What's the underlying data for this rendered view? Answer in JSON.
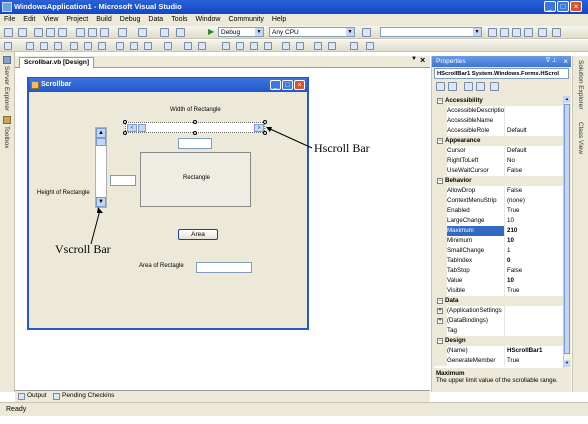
{
  "window": {
    "title": "WindowsApplication1 - Microsoft Visual Studio"
  },
  "menu": [
    "File",
    "Edit",
    "View",
    "Project",
    "Build",
    "Debug",
    "Data",
    "Tools",
    "Window",
    "Community",
    "Help"
  ],
  "toolbar": {
    "config": "Debug",
    "platform": "Any CPU"
  },
  "left_strip": {
    "server_explorer": "Server Explorer",
    "toolbox": "Toolbox"
  },
  "document": {
    "tab_label": "Scrollbar.vb [Design]",
    "close": "×"
  },
  "form": {
    "title": "Scrollbar",
    "width_label": "Width of Rectangle",
    "height_label": "Height of Rectangle",
    "rectangle_label": "Rectangle",
    "area_button": "Area",
    "area_label": "Area of Rectagle"
  },
  "annotations": {
    "hscroll": "Hscroll  Bar",
    "vscroll": "Vscroll  Bar"
  },
  "properties": {
    "title": "Properties",
    "object": "HScrollBar1  System.Windows.Forms.HScrol",
    "rows": [
      {
        "type": "cat",
        "name": "Accessibility"
      },
      {
        "name": "AccessibleDescriptio",
        "value": ""
      },
      {
        "name": "AccessibleName",
        "value": ""
      },
      {
        "name": "AccessibleRole",
        "value": "Default"
      },
      {
        "type": "cat",
        "name": "Appearance"
      },
      {
        "name": "Cursor",
        "value": "Default"
      },
      {
        "name": "RightToLeft",
        "value": "No"
      },
      {
        "name": "UseWaitCursor",
        "value": "False"
      },
      {
        "type": "cat",
        "name": "Behavior"
      },
      {
        "name": "AllowDrop",
        "value": "False"
      },
      {
        "name": "ContextMenuStrip",
        "value": "(none)"
      },
      {
        "name": "Enabled",
        "value": "True"
      },
      {
        "name": "LargeChange",
        "value": "10"
      },
      {
        "name": "Maximum",
        "value": "210",
        "sel": true,
        "bold": true
      },
      {
        "name": "Minimum",
        "value": "10",
        "bold": true
      },
      {
        "name": "SmallChange",
        "value": "1"
      },
      {
        "name": "TabIndex",
        "value": "0",
        "bold": true
      },
      {
        "name": "TabStop",
        "value": "False"
      },
      {
        "name": "Value",
        "value": "10",
        "bold": true
      },
      {
        "name": "Visible",
        "value": "True"
      },
      {
        "type": "cat",
        "name": "Data"
      },
      {
        "name": "(ApplicationSettings",
        "value": "",
        "exp": true
      },
      {
        "name": "(DataBindings)",
        "value": "",
        "exp": true
      },
      {
        "name": "Tag",
        "value": ""
      },
      {
        "type": "cat",
        "name": "Design"
      },
      {
        "name": "(Name)",
        "value": "HScrollBar1",
        "bold": true
      },
      {
        "name": "GenerateMember",
        "value": "True"
      }
    ],
    "desc_title": "Maximum",
    "desc_text": "The upper limit value of the scrollable range."
  },
  "right_strip": {
    "solution_explorer": "Solution Explorer",
    "class_view": "Class View"
  },
  "bottom_tabs": {
    "output": "Output",
    "pending": "Pending Checkins"
  },
  "status": "Ready"
}
